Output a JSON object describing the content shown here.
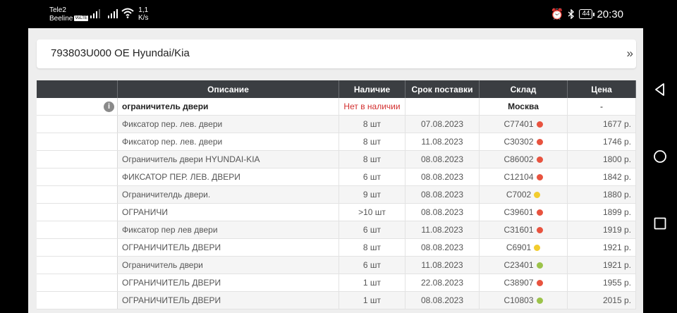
{
  "status": {
    "carrier1": "Tele2",
    "carrier2": "Beeline",
    "volte": "VoLTE",
    "speed_value": "1,1",
    "speed_unit": "K/s",
    "battery": "44",
    "time": "20:30"
  },
  "title": "793803U000 OE Hyundai/Kia",
  "headers": [
    "Описание",
    "Наличие",
    "Срок поставки",
    "Склад",
    "Цена"
  ],
  "main_row": {
    "description": "ограничитель двери",
    "availability": "Нет в наличии",
    "delivery": "",
    "warehouse": "Москва",
    "price": "-"
  },
  "colors": {
    "red": "#e8533f",
    "yellow": "#f2cc2e",
    "green": "#9cc34a"
  },
  "rows": [
    {
      "description": "Фиксатор пер. лев. двери",
      "qty": "8 шт",
      "date": "07.08.2023",
      "warehouse": "C77401",
      "dot": "red",
      "price": "1677 р."
    },
    {
      "description": "Фиксатор пер. лев. двери",
      "qty": "8 шт",
      "date": "11.08.2023",
      "warehouse": "C30302",
      "dot": "red",
      "price": "1746 р."
    },
    {
      "description": "Ограничитель двери HYUNDAI-KIA",
      "qty": "8 шт",
      "date": "08.08.2023",
      "warehouse": "C86002",
      "dot": "red",
      "price": "1800 р."
    },
    {
      "description": "ФИКСАТОР ПЕР. ЛЕВ. ДВЕРИ",
      "qty": "6 шт",
      "date": "08.08.2023",
      "warehouse": "C12104",
      "dot": "red",
      "price": "1842 р."
    },
    {
      "description": "Ограничителдь двери.",
      "qty": "9 шт",
      "date": "08.08.2023",
      "warehouse": "C7002",
      "dot": "yellow",
      "price": "1880 р."
    },
    {
      "description": "ОГРАНИЧИ",
      "qty": ">10 шт",
      "date": "08.08.2023",
      "warehouse": "C39601",
      "dot": "red",
      "price": "1899 р."
    },
    {
      "description": "Фиксатор пер лев двери",
      "qty": "6 шт",
      "date": "11.08.2023",
      "warehouse": "C31601",
      "dot": "red",
      "price": "1919 р."
    },
    {
      "description": "ОГРАНИЧИТЕЛЬ ДВЕРИ",
      "qty": "8 шт",
      "date": "08.08.2023",
      "warehouse": "C6901",
      "dot": "yellow",
      "price": "1921 р."
    },
    {
      "description": "Ограничитель двери",
      "qty": "6 шт",
      "date": "11.08.2023",
      "warehouse": "C23401",
      "dot": "green",
      "price": "1921 р."
    },
    {
      "description": "ОГРАНИЧИТЕЛЬ ДВЕРИ",
      "qty": "1 шт",
      "date": "22.08.2023",
      "warehouse": "C38907",
      "dot": "red",
      "price": "1955 р."
    },
    {
      "description": "ОГРАНИЧИТЕЛЬ ДВЕРИ",
      "qty": "1 шт",
      "date": "08.08.2023",
      "warehouse": "C10803",
      "dot": "green",
      "price": "2015 р."
    }
  ]
}
